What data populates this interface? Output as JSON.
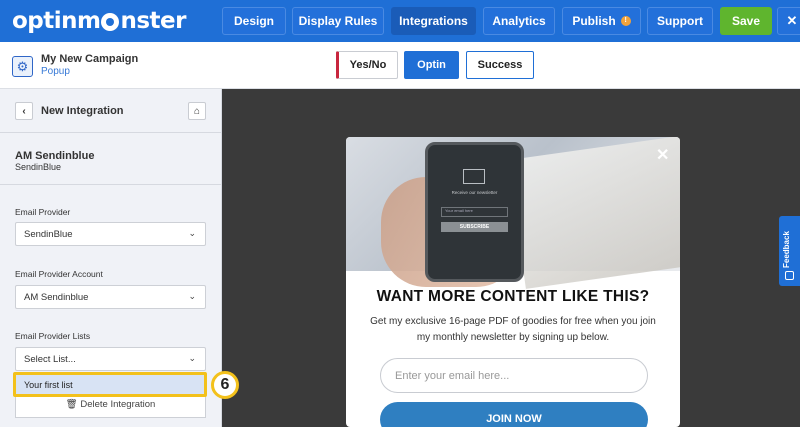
{
  "brand": {
    "logo_text_left": "optinm",
    "logo_text_right": "nster"
  },
  "nav": {
    "design": "Design",
    "display_rules": "Display Rules",
    "integrations": "Integrations",
    "analytics": "Analytics",
    "publish": "Publish",
    "support": "Support",
    "save": "Save",
    "close": "✕"
  },
  "campaign": {
    "name": "My New Campaign",
    "type": "Popup"
  },
  "views": {
    "yesno": "Yes/No",
    "optin": "Optin",
    "success": "Success"
  },
  "sidebar": {
    "back": "‹",
    "title": "New Integration",
    "integration_name": "AM Sendinblue",
    "integration_sub": "SendinBlue",
    "provider_label": "Email Provider",
    "provider_value": "SendinBlue",
    "account_label": "Email Provider Account",
    "account_value": "AM Sendinblue",
    "lists_label": "Email Provider Lists",
    "lists_value": "Select List...",
    "list_option": "Your first list",
    "delete": "Delete Integration"
  },
  "callout": {
    "number": "6"
  },
  "popup": {
    "phone_caption": "Receive our newsletter",
    "phone_input": "Your email here",
    "phone_button": "SUBSCRIBE",
    "title": "WANT MORE CONTENT LIKE THIS?",
    "description": "Get my exclusive 16-page PDF of goodies for free when you join my monthly newsletter by signing up below.",
    "email_placeholder": "Enter your email here...",
    "join": "JOIN NOW"
  },
  "feedback": "Feedback"
}
